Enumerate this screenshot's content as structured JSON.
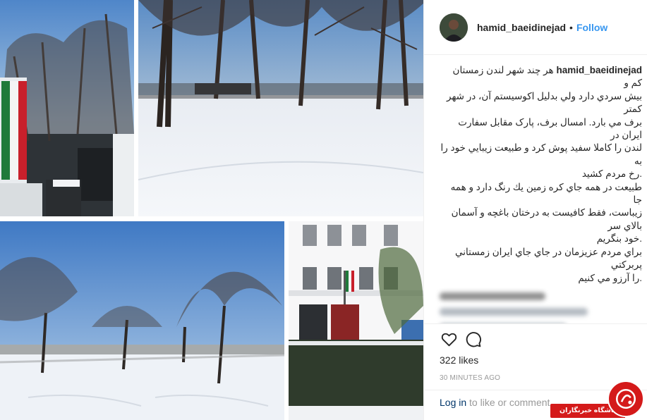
{
  "post": {
    "username": "hamid_baeidinejad",
    "separator": "•",
    "follow_label": "Follow",
    "caption_user": "hamid_baeidinejad",
    "caption_lines": [
      "هر چند شهر لندن زمستان کم و",
      "بيش سردي دارد ولي بدليل اکوسيستم آن، در شهر کمتر",
      "برف مي بارد. امسال برف، پارک مقابل سفارت ايران در",
      "لندن را کاملا سفيد پوش کرد و طبيعت زيبايي خود را به",
      ".رخ مردم کشيد",
      "طبيعت در همه جاي کره زمين يك رنگ دارد و همه جا",
      "زيباست، فقط کافيست به درختان باغچه و آسمان بالاي سر",
      ".خود بنگريم",
      "براي مردم عزيزمان در جاي جاي ايران زمستاني پربرکتي",
      ".را آرزو مي کنيم"
    ],
    "likes": "322 likes",
    "time": "30 MINUTES AGO",
    "login_link": "Log in",
    "login_text": " to like or comment."
  },
  "icons": {
    "like": "heart-icon",
    "comment": "comment-icon"
  },
  "watermark": {
    "text": "باشگاه خبرنگاران"
  },
  "colors": {
    "accent": "#3897f0",
    "link": "#003569",
    "watermark": "#d41a1a"
  }
}
